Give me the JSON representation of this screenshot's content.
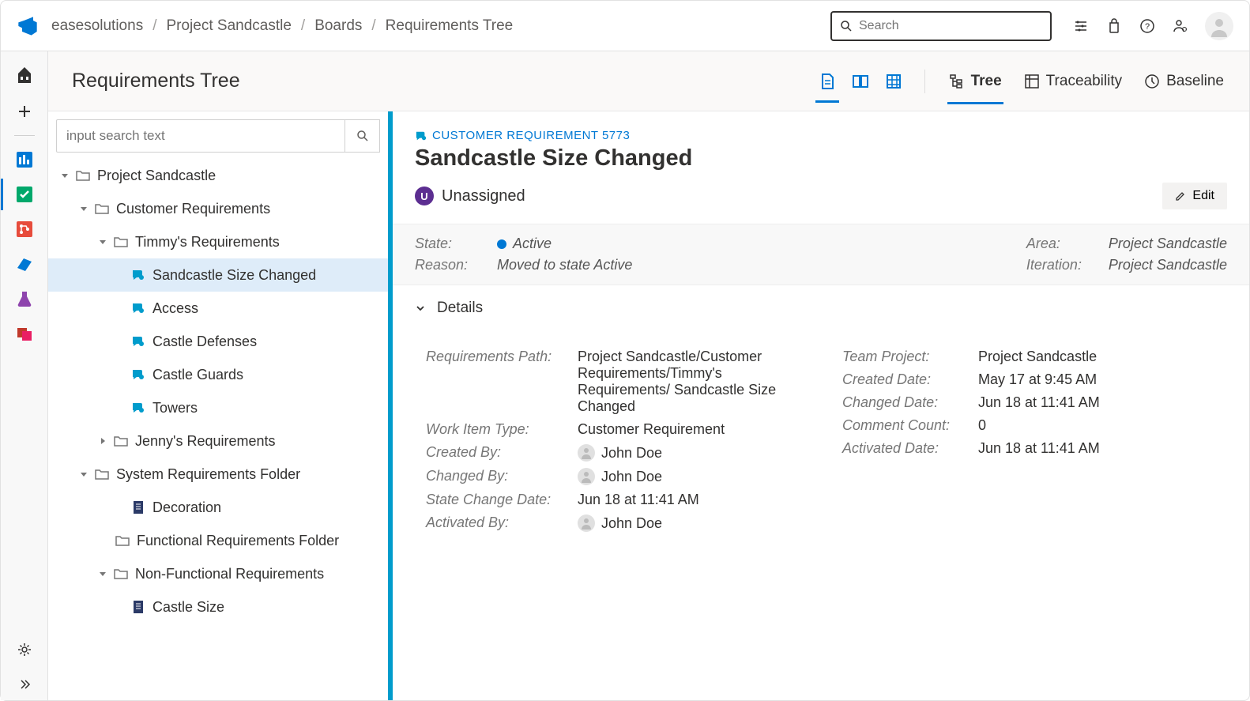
{
  "header": {
    "search_placeholder": "Search",
    "breadcrumb": [
      "easesolutions",
      "Project Sandcastle",
      "Boards",
      "Requirements Tree"
    ]
  },
  "page": {
    "title": "Requirements Tree",
    "view_tabs": {
      "tree": "Tree",
      "traceability": "Traceability",
      "baseline": "Baseline"
    }
  },
  "tree": {
    "search_placeholder": "input search text",
    "nodes": {
      "root": "Project Sandcastle",
      "customer_req": "Customer Requirements",
      "timmy": "Timmy's Requirements",
      "sandcastle_size": "Sandcastle Size Changed",
      "access": "Access",
      "castle_defenses": "Castle Defenses",
      "castle_guards": "Castle Guards",
      "towers": "Towers",
      "jenny": "Jenny's Requirements",
      "system_folder": "System Requirements Folder",
      "decoration": "Decoration",
      "func_folder": "Functional Requirements Folder",
      "nonfunc": "Non-Functional Requirements",
      "castle_size": "Castle Size"
    }
  },
  "detail": {
    "type_label": "CUSTOMER REQUIREMENT 5773",
    "title": "Sandcastle Size Changed",
    "assignee": "Unassigned",
    "edit_label": "Edit",
    "status": {
      "state_label": "State:",
      "state_value": "Active",
      "reason_label": "Reason:",
      "reason_value": "Moved to state Active",
      "area_label": "Area:",
      "area_value": "Project Sandcastle",
      "iteration_label": "Iteration:",
      "iteration_value": "Project Sandcastle"
    },
    "details_section_label": "Details",
    "fields": {
      "req_path_label": "Requirements Path:",
      "req_path_value": "Project Sandcastle/Customer Requirements/Timmy's Requirements/ Sandcastle Size Changed",
      "work_item_type_label": "Work Item Type:",
      "work_item_type_value": "Customer Requirement",
      "created_by_label": "Created By:",
      "created_by_value": "John Doe",
      "changed_by_label": "Changed By:",
      "changed_by_value": "John Doe",
      "state_change_date_label": "State Change Date:",
      "state_change_date_value": "Jun 18 at 11:41 AM",
      "activated_by_label": "Activated By:",
      "activated_by_value": "John Doe",
      "team_project_label": "Team Project:",
      "team_project_value": "Project Sandcastle",
      "created_date_label": "Created Date:",
      "created_date_value": "May 17 at 9:45 AM",
      "changed_date_label": "Changed Date:",
      "changed_date_value": "Jun 18 at 11:41 AM",
      "comment_count_label": "Comment Count:",
      "comment_count_value": "0",
      "activated_date_label": "Activated Date:",
      "activated_date_value": "Jun 18 at 11:41 AM"
    }
  }
}
